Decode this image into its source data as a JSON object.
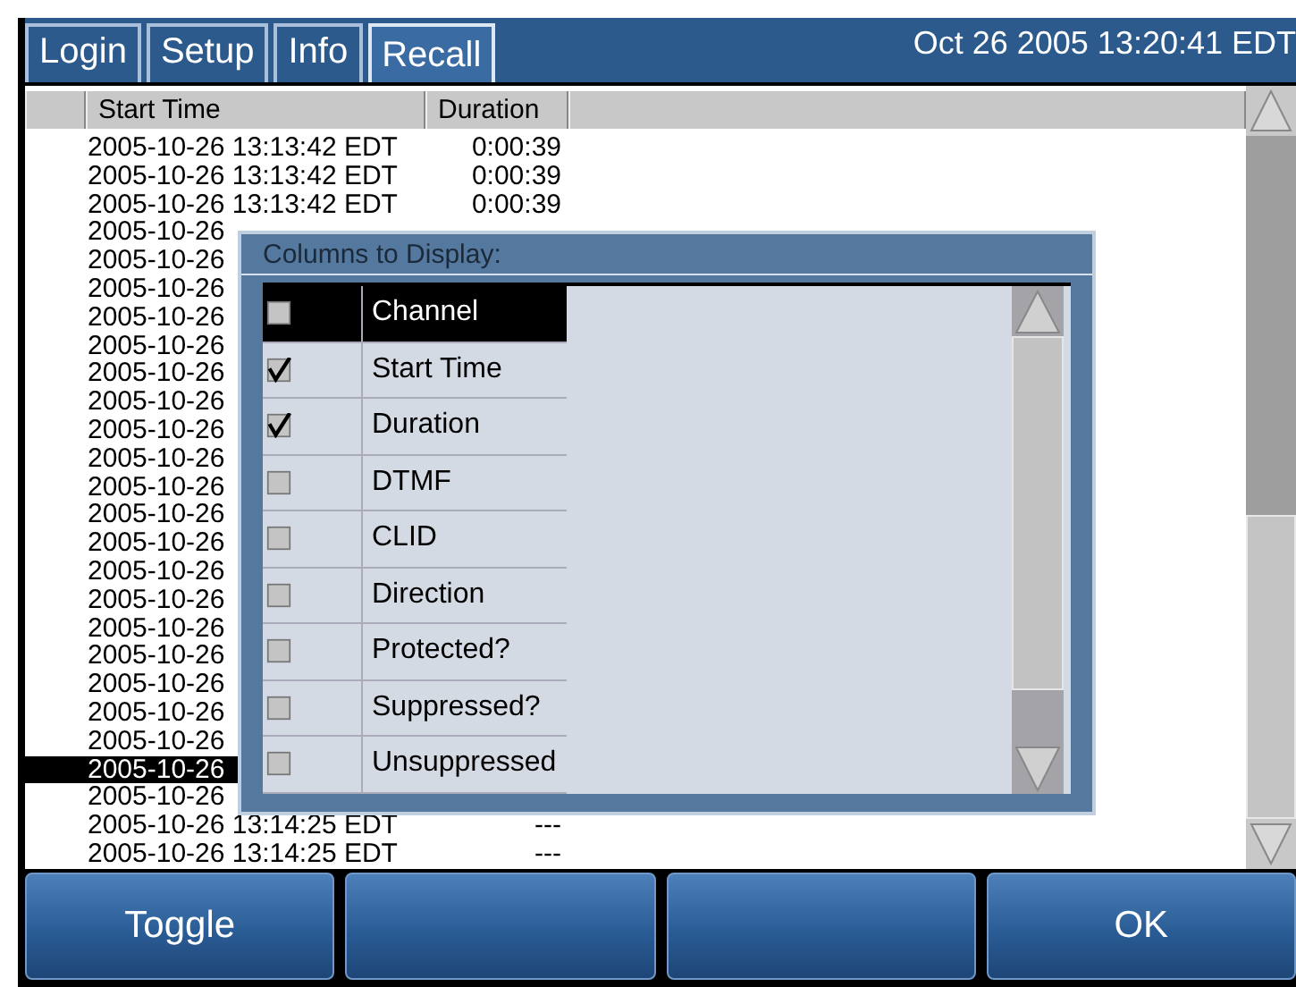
{
  "tabs": [
    {
      "label": "Login",
      "selected": false
    },
    {
      "label": "Setup",
      "selected": false
    },
    {
      "label": "Info",
      "selected": false
    },
    {
      "label": "Recall",
      "selected": true
    }
  ],
  "clock": "Oct 26 2005 13:20:41 EDT",
  "table": {
    "columns": [
      "Start Time",
      "Duration"
    ],
    "rows": [
      {
        "start": "2005-10-26 13:13:42 EDT",
        "duration": "0:00:39",
        "selected": false
      },
      {
        "start": "2005-10-26 13:13:42 EDT",
        "duration": "0:00:39",
        "selected": false
      },
      {
        "start": "2005-10-26 13:13:42 EDT",
        "duration": "0:00:39",
        "selected": false
      },
      {
        "start": "2005-10-26",
        "selected": false
      },
      {
        "start": "2005-10-26",
        "selected": false
      },
      {
        "start": "2005-10-26",
        "selected": false
      },
      {
        "start": "2005-10-26",
        "selected": false
      },
      {
        "start": "2005-10-26",
        "selected": false
      },
      {
        "start": "2005-10-26",
        "selected": false
      },
      {
        "start": "2005-10-26",
        "selected": false
      },
      {
        "start": "2005-10-26",
        "selected": false
      },
      {
        "start": "2005-10-26",
        "selected": false
      },
      {
        "start": "2005-10-26",
        "selected": false
      },
      {
        "start": "2005-10-26",
        "selected": false
      },
      {
        "start": "2005-10-26",
        "selected": false
      },
      {
        "start": "2005-10-26",
        "selected": false
      },
      {
        "start": "2005-10-26",
        "selected": false
      },
      {
        "start": "2005-10-26",
        "selected": false
      },
      {
        "start": "2005-10-26",
        "selected": false
      },
      {
        "start": "2005-10-26",
        "selected": false
      },
      {
        "start": "2005-10-26",
        "selected": false
      },
      {
        "start": "2005-10-26",
        "selected": false
      },
      {
        "start": "2005-10-26",
        "selected": true
      },
      {
        "start": "2005-10-26",
        "selected": false
      },
      {
        "start": "2005-10-26 13:14:25 EDT",
        "duration": "---",
        "selected": false
      },
      {
        "start": "2005-10-26 13:14:25 EDT",
        "duration": "---",
        "selected": false
      }
    ]
  },
  "dialog": {
    "title": "Columns to Display:",
    "items": [
      {
        "label": "Channel",
        "checked": false,
        "selected": true
      },
      {
        "label": "Start Time",
        "checked": true,
        "selected": false
      },
      {
        "label": "Duration",
        "checked": true,
        "selected": false
      },
      {
        "label": "DTMF",
        "checked": false,
        "selected": false
      },
      {
        "label": "CLID",
        "checked": false,
        "selected": false
      },
      {
        "label": "Direction",
        "checked": false,
        "selected": false
      },
      {
        "label": "Protected?",
        "checked": false,
        "selected": false
      },
      {
        "label": "Suppressed?",
        "checked": false,
        "selected": false
      },
      {
        "label": "Unsuppressed",
        "checked": false,
        "selected": false
      }
    ]
  },
  "buttons": [
    {
      "kind": "label",
      "label": "Toggle"
    },
    {
      "kind": "blank"
    },
    {
      "kind": "blank"
    },
    {
      "kind": "label",
      "label": "OK"
    }
  ]
}
